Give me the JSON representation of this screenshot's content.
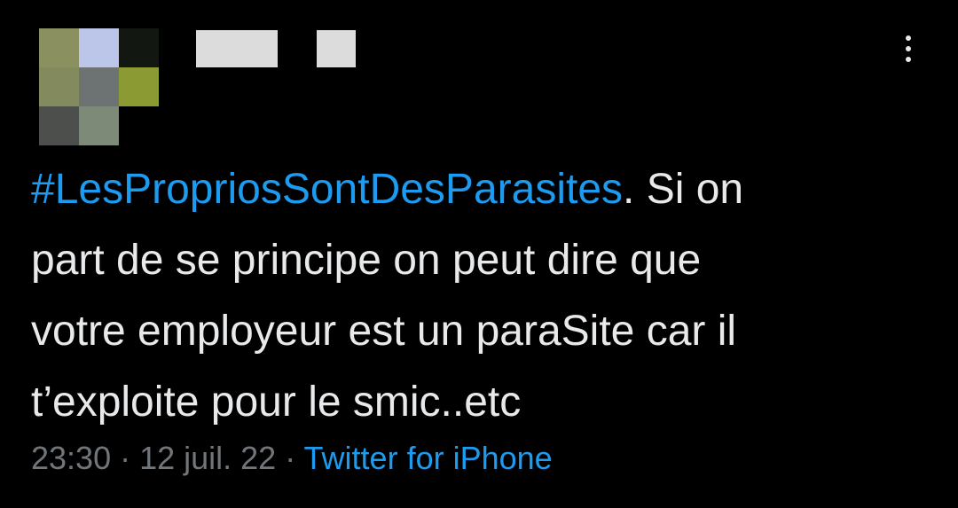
{
  "avatar": {
    "pixels": [
      [
        "#8a9060",
        "#bcc6e8",
        "#131712"
      ],
      [
        "#838a5e",
        "#6d7272",
        "#8c9a33"
      ],
      [
        "#4d4f4d",
        "#7d8a78",
        "#000000"
      ]
    ]
  },
  "menu": {
    "icon": "more-vertical-icon"
  },
  "tweet": {
    "hashtag": "#LesPropriosSontDesParasites",
    "line1_rest": ". Si on",
    "line2": "part de se principe on peut dire que",
    "line3": "votre employeur est un paraSite car il",
    "line4": "t’exploite pour le smic..etc"
  },
  "meta": {
    "time": "23:30",
    "separator": " · ",
    "date": "12 juil. 22",
    "source": "Twitter for iPhone"
  },
  "colors": {
    "background": "#000000",
    "text": "#e7e9ea",
    "link": "#1d9bf0",
    "muted": "#71767b"
  }
}
